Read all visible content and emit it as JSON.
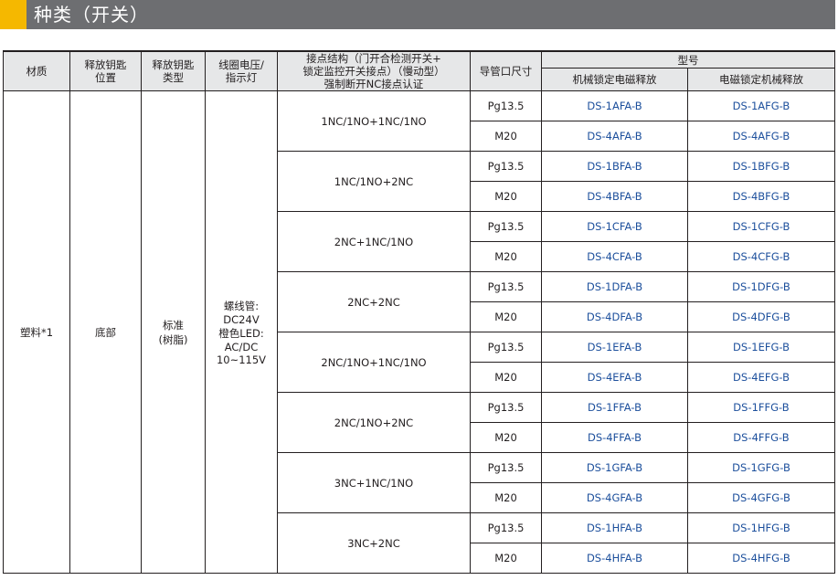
{
  "title": {
    "text": "种类（开关）",
    "accent_color": "#f5b800",
    "bar_color": "#6d6e71"
  },
  "header": {
    "material": "材质",
    "release_key_position": "释放钥匙\n位置",
    "release_key_type": "释放钥匙\n类型",
    "coil_voltage": "线圈电压/\n指示灯",
    "contact_structure": "接点结构（门开合检测开关+\n锁定监控开关接点）（慢动型）\n强制断开NC接点认证",
    "conduit_size": "导管口尺寸",
    "model": "型号",
    "mech_lock": "机械锁定电磁释放",
    "elec_lock": "电磁锁定机械释放"
  },
  "common": {
    "material": "塑料*1",
    "release_key_position": "底部",
    "release_key_type": "标准\n(树脂)",
    "coil_voltage": "螺线管:\nDC24V\n橙色LED:\nAC/DC\n10~115V"
  },
  "groups": [
    {
      "contact": "1NC/1NO+1NC/1NO",
      "rows": [
        {
          "conduit": "Pg13.5",
          "mech": "DS-1AFA-B",
          "elec": "DS-1AFG-B"
        },
        {
          "conduit": "M20",
          "mech": "DS-4AFA-B",
          "elec": "DS-4AFG-B"
        }
      ]
    },
    {
      "contact": "1NC/1NO+2NC",
      "rows": [
        {
          "conduit": "Pg13.5",
          "mech": "DS-1BFA-B",
          "elec": "DS-1BFG-B"
        },
        {
          "conduit": "M20",
          "mech": "DS-4BFA-B",
          "elec": "DS-4BFG-B"
        }
      ]
    },
    {
      "contact": "2NC+1NC/1NO",
      "rows": [
        {
          "conduit": "Pg13.5",
          "mech": "DS-1CFA-B",
          "elec": "DS-1CFG-B"
        },
        {
          "conduit": "M20",
          "mech": "DS-4CFA-B",
          "elec": "DS-4CFG-B"
        }
      ]
    },
    {
      "contact": "2NC+2NC",
      "rows": [
        {
          "conduit": "Pg13.5",
          "mech": "DS-1DFA-B",
          "elec": "DS-1DFG-B"
        },
        {
          "conduit": "M20",
          "mech": "DS-4DFA-B",
          "elec": "DS-4DFG-B"
        }
      ]
    },
    {
      "contact": "2NC/1NO+1NC/1NO",
      "rows": [
        {
          "conduit": "Pg13.5",
          "mech": "DS-1EFA-B",
          "elec": "DS-1EFG-B"
        },
        {
          "conduit": "M20",
          "mech": "DS-4EFA-B",
          "elec": "DS-4EFG-B"
        }
      ]
    },
    {
      "contact": "2NC/1NO+2NC",
      "rows": [
        {
          "conduit": "Pg13.5",
          "mech": "DS-1FFA-B",
          "elec": "DS-1FFG-B"
        },
        {
          "conduit": "M20",
          "mech": "DS-4FFA-B",
          "elec": "DS-4FFG-B"
        }
      ]
    },
    {
      "contact": "3NC+1NC/1NO",
      "rows": [
        {
          "conduit": "Pg13.5",
          "mech": "DS-1GFA-B",
          "elec": "DS-1GFG-B"
        },
        {
          "conduit": "M20",
          "mech": "DS-4GFA-B",
          "elec": "DS-4GFG-B"
        }
      ]
    },
    {
      "contact": "3NC+2NC",
      "rows": [
        {
          "conduit": "Pg13.5",
          "mech": "DS-1HFA-B",
          "elec": "DS-1HFG-B"
        },
        {
          "conduit": "M20",
          "mech": "DS-4HFA-B",
          "elec": "DS-4HFG-B"
        }
      ]
    }
  ]
}
